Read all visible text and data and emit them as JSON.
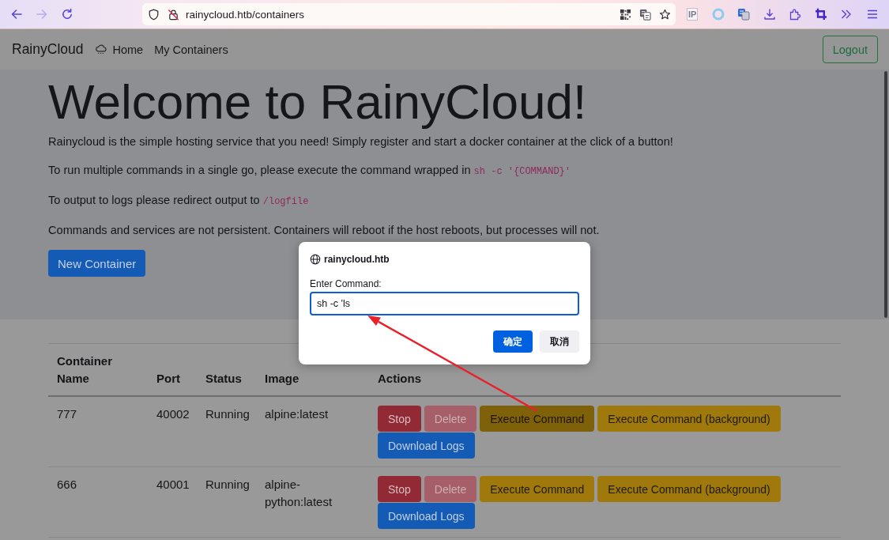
{
  "browser": {
    "nav_buttons": [
      {
        "kind": "back",
        "disabled": false
      },
      {
        "kind": "forward",
        "disabled": true
      },
      {
        "kind": "reload",
        "disabled": false
      }
    ],
    "url": "rainycloud.htb/containers",
    "extension_badge": "IP"
  },
  "navbar": {
    "brand": "RainyCloud",
    "links": [
      {
        "label": "Home",
        "icon": true
      },
      {
        "label": "My Containers",
        "icon": false
      }
    ],
    "logout": "Logout"
  },
  "hero": {
    "title": "Welcome to RainyCloud!",
    "paragraphs": [
      {
        "text": "Rainycloud is the simple hosting service that you need! Simply register and start a docker container at the click of a button!"
      },
      {
        "text": "To run multiple commands in a single go, please execute the command wrapped in",
        "code": "sh -c '{COMMAND}'"
      },
      {
        "text": "To output to logs please redirect output to",
        "code": "/logfile"
      },
      {
        "text": "Commands and services are not persistent. Containers will reboot if the host reboots, but processes will not."
      }
    ],
    "button": "New Container"
  },
  "table": {
    "columns": [
      "Container Name",
      "Port",
      "Status",
      "Image",
      "Actions"
    ],
    "rows": [
      {
        "cells": [
          "777",
          "40002",
          "Running",
          "alpine:latest"
        ],
        "actions": [
          {
            "label": "Stop",
            "kind": "danger",
            "disabled": false,
            "hovered": false
          },
          {
            "label": "Delete",
            "kind": "danger",
            "disabled": true,
            "hovered": false
          },
          {
            "label": "Execute Command",
            "kind": "warning",
            "disabled": false,
            "hovered": true
          },
          {
            "label": "Execute Command (background)",
            "kind": "warning",
            "disabled": false,
            "hovered": false
          },
          {
            "label": "Download Logs",
            "kind": "primary",
            "disabled": false,
            "hovered": false
          }
        ]
      },
      {
        "cells": [
          "666",
          "40001",
          "Running",
          "alpine-python:latest"
        ],
        "actions": [
          {
            "label": "Stop",
            "kind": "danger",
            "disabled": false,
            "hovered": false
          },
          {
            "label": "Delete",
            "kind": "danger",
            "disabled": true,
            "hovered": false
          },
          {
            "label": "Execute Command",
            "kind": "warning",
            "disabled": false,
            "hovered": false
          },
          {
            "label": "Execute Command (background)",
            "kind": "warning",
            "disabled": false,
            "hovered": false
          },
          {
            "label": "Download Logs",
            "kind": "primary",
            "disabled": false,
            "hovered": false
          }
        ]
      }
    ]
  },
  "dialog": {
    "origin": "rainycloud.htb",
    "prompt": "Enter Command:",
    "value": "sh -c 'ls",
    "focused": true,
    "buttons": [
      {
        "label": "确定",
        "kind": "primary"
      },
      {
        "label": "取消",
        "kind": "secondary"
      }
    ]
  },
  "annotations": [
    {
      "kind": "arrow"
    }
  ]
}
